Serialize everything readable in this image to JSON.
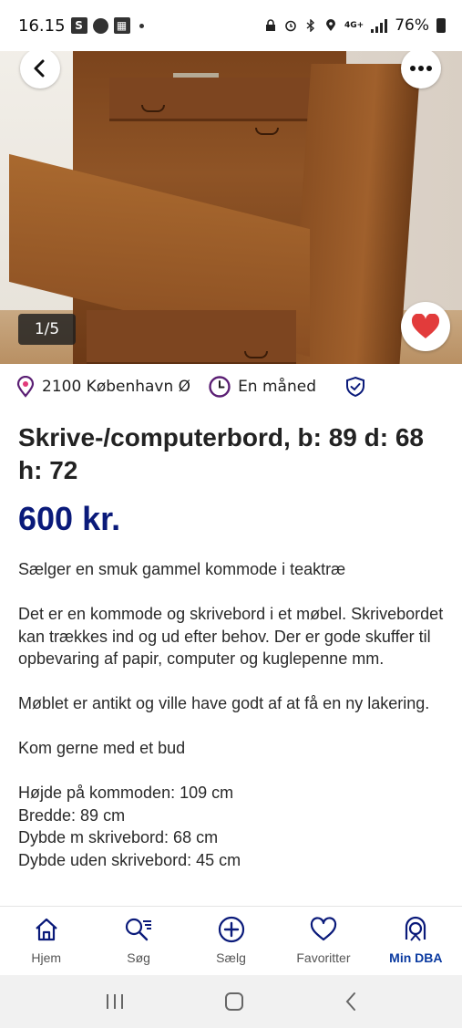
{
  "status_bar": {
    "time": "16.15",
    "s_badge": "S",
    "battery": "76%"
  },
  "gallery": {
    "counter": "1/5"
  },
  "meta": {
    "location": "2100 København Ø",
    "age": "En måned"
  },
  "listing": {
    "title": "Skrive-/computerbord, b: 89 d: 68 h: 72",
    "price": "600 kr.",
    "description": [
      "Sælger en smuk gammel kommode i teaktræ",
      "Det er en kommode og skrivebord i et møbel. Skrivebordet kan trækkes ind og ud efter behov. Der er gode skuffer til opbevaring af papir, computer og kuglepenne mm.",
      "Møblet er antikt og ville have godt af at få en ny lakering.",
      "Kom gerne med et bud"
    ],
    "dimensions": [
      "Højde på kommoden: 109 cm",
      "Bredde: 89 cm",
      "Dybde m skrivebord: 68 cm",
      "Dybde uden skrivebord: 45 cm"
    ]
  },
  "bottom_nav": [
    {
      "label": "Hjem",
      "icon": "home-icon"
    },
    {
      "label": "Søg",
      "icon": "search-icon"
    },
    {
      "label": "Sælg",
      "icon": "add-circle-icon"
    },
    {
      "label": "Favoritter",
      "icon": "heart-icon"
    },
    {
      "label": "Min DBA",
      "icon": "profile-icon",
      "active": true
    }
  ],
  "colors": {
    "brand_navy": "#0a1a7a",
    "accent_purple": "#5b1f74",
    "favorite_red": "#e23b3b",
    "active_nav": "#0a3aa0"
  }
}
